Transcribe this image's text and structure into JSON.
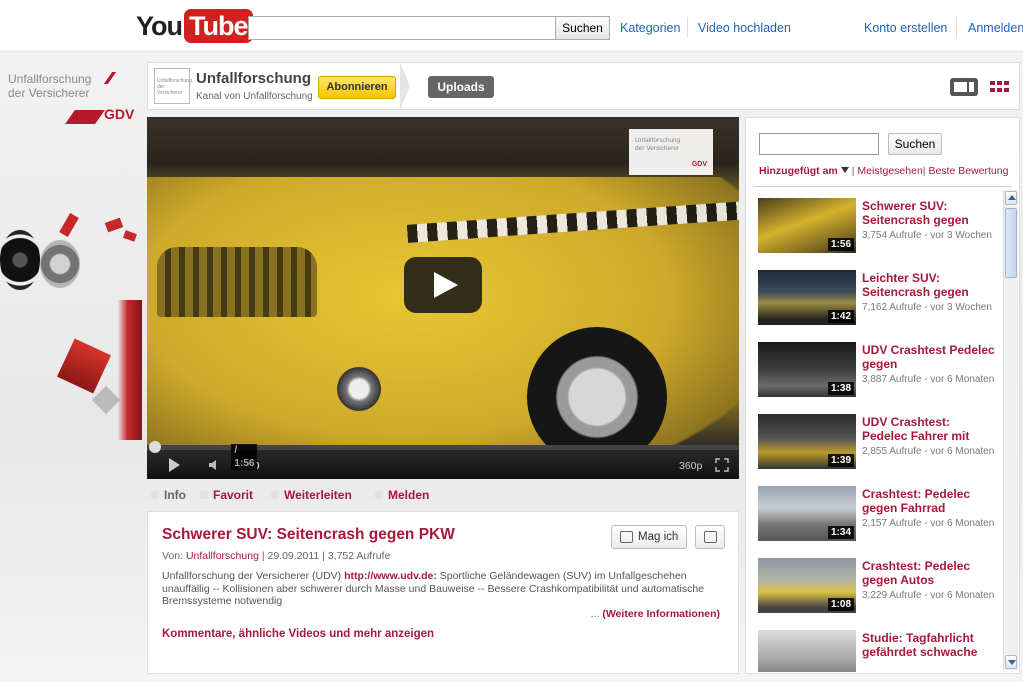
{
  "header": {
    "logo_you": "You",
    "logo_tube": "Tube",
    "search_button": "Suchen",
    "links": [
      "Kategorien",
      "Video hochladen",
      "Konto erstellen",
      "Anmelden"
    ]
  },
  "brand": {
    "line1": "Unfallforschung",
    "line2": "der Versicherer",
    "gdv": "GDV"
  },
  "channel": {
    "thumb_text": "Unfallforschung der Versicherer",
    "name": "Unfallforschung",
    "subtitle": "Kanal von Unfallforschung",
    "subscribe": "Abonnieren",
    "uploads": "Uploads"
  },
  "player": {
    "watermark_l1": "Unfallforschung",
    "watermark_l2": "der Versicherer",
    "watermark_gdv": "GDV",
    "current_time": "0:00",
    "duration": "/ 1:56",
    "quality": "360p",
    "progress": 0
  },
  "actions": [
    "Info",
    "Favorit",
    "Weiterleiten",
    "Melden"
  ],
  "video": {
    "title": "Schwerer SUV: Seitencrash gegen PKW",
    "by_label": "Von:",
    "author": "Unfallforschung",
    "date_views": "| 29.09.2011 | 3,752 Aufrufe",
    "desc_prefix": "Unfallforschung der Versicherer (UDV)",
    "desc_url": "http://www.udv.de:",
    "desc_text": "Sportliche Geländewagen (SUV) im Unfallgeschehen unauffällig -- Kollisionen aber schwerer durch Masse und Bauweise -- Bessere Crashkompatibilität und automatische Bremssysteme notwendig",
    "more_dots": "...",
    "more_label": "(Weitere Informationen)",
    "comments_link": "Kommentare, ähnliche Videos und mehr anzeigen",
    "like": "Mag ich"
  },
  "sidebar": {
    "search_button": "Suchen",
    "sort_active": "Hinzugefügt am",
    "sort_most_viewed": "Meistgesehen",
    "sort_best": "Beste Bewertung",
    "items": [
      {
        "title": "Schwerer SUV: Seitencrash gegen",
        "meta": "3,754 Aufrufe - vor 3 Wochen",
        "duration": "1:56"
      },
      {
        "title": "Leichter SUV: Seitencrash gegen",
        "meta": "7,162 Aufrufe - vor 3 Wochen",
        "duration": "1:42"
      },
      {
        "title": "UDV Crashtest Pedelec gegen",
        "meta": "3,887 Aufrufe - vor 6 Monaten",
        "duration": "1:38"
      },
      {
        "title": "UDV Crashtest: Pedelec Fahrer mit",
        "meta": "2,855 Aufrufe - vor 6 Monaten",
        "duration": "1:39"
      },
      {
        "title": "Crashtest: Pedelec gegen Fahrrad",
        "meta": "2,157 Aufrufe - vor 6 Monaten",
        "duration": "1:34"
      },
      {
        "title": "Crashtest: Pedelec gegen Autos",
        "meta": "3,229 Aufrufe - vor 6 Monaten",
        "duration": "1:08"
      },
      {
        "title": "Studie: Tagfahrlicht gefährdet schwache",
        "meta": "",
        "duration": ""
      }
    ]
  },
  "colors": {
    "accent": "#a5193a",
    "brand_red": "#b5192b",
    "link_blue": "#1c62b9"
  }
}
